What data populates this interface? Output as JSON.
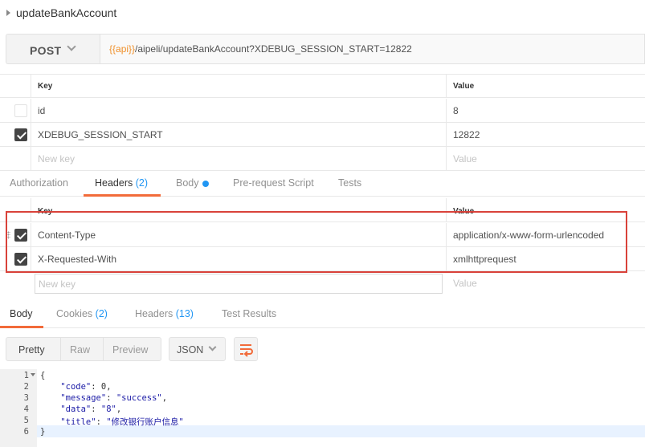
{
  "request": {
    "name": "updateBankAccount",
    "method": "POST",
    "url_variable": "{{api}}",
    "url_path": "/aipeli/updateBankAccount?XDEBUG_SESSION_START=12822"
  },
  "params": {
    "columns": {
      "key": "Key",
      "value": "Value"
    },
    "rows": [
      {
        "key": "id",
        "value": "8",
        "checked": false
      },
      {
        "key": "XDEBUG_SESSION_START",
        "value": "12822",
        "checked": true
      }
    ],
    "new_key_placeholder": "New key",
    "new_value_placeholder": "Value"
  },
  "request_tabs": {
    "authorization": "Authorization",
    "headers": "Headers",
    "headers_count": "(2)",
    "body": "Body",
    "prerequest": "Pre-request Script",
    "tests": "Tests",
    "active": "headers"
  },
  "headers": {
    "columns": {
      "key": "Key",
      "value": "Value"
    },
    "rows": [
      {
        "key": "Content-Type",
        "value": "application/x-www-form-urlencoded",
        "checked": true
      },
      {
        "key": "X-Requested-With",
        "value": "xmlhttprequest",
        "checked": true
      }
    ],
    "new_key_placeholder": "New key",
    "new_value_placeholder": "Value"
  },
  "response_tabs": {
    "body": "Body",
    "cookies": "Cookies",
    "cookies_count": "(2)",
    "headers": "Headers",
    "headers_count": "(13)",
    "test_results": "Test Results",
    "active": "body"
  },
  "response_toolbar": {
    "pretty": "Pretty",
    "raw": "Raw",
    "preview": "Preview",
    "format": "JSON",
    "wrap_icon": "wrap-lines-icon"
  },
  "response_body": {
    "line_numbers": [
      "1",
      "2",
      "3",
      "4",
      "5",
      "6"
    ],
    "open_brace": "{",
    "close_brace": "}",
    "fields": [
      {
        "key": "\"code\"",
        "value": "0",
        "trail": ","
      },
      {
        "key": "\"message\"",
        "value": "\"success\"",
        "trail": ","
      },
      {
        "key": "\"data\"",
        "value": "\"8\"",
        "trail": ","
      },
      {
        "key": "\"title\"",
        "value": "\"修改银行账户信息\"",
        "trail": ""
      }
    ]
  },
  "colors": {
    "accent": "#f26b3a",
    "count_blue": "#2196f3",
    "url_variable": "#f0902a",
    "highlight_red": "#d9423a"
  }
}
